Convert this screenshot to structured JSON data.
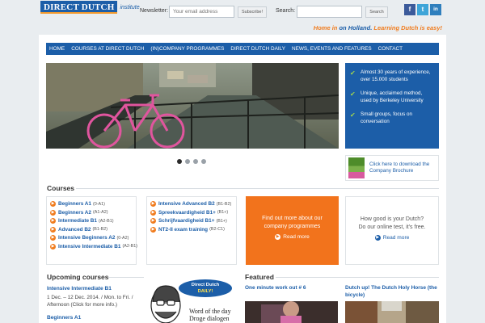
{
  "header": {
    "logo_text": "DIRECT DUTCH",
    "logo_sub": "institute",
    "newsletter_label": "Newsletter:",
    "newsletter_placeholder": "Your email address",
    "subscribe_label": "Subscribe!",
    "search_label": "Search:",
    "search_button": "Search",
    "social": [
      "f",
      "t",
      "in"
    ]
  },
  "tagline": {
    "part1": "Home in ",
    "part2": "on Holland.",
    "part3": " Learning Dutch is easy!"
  },
  "nav": [
    "HOME",
    "COURSES AT DIRECT DUTCH",
    "(IN)COMPANY PROGRAMMES",
    "DIRECT DUTCH DAILY",
    "NEWS, EVENTS AND FEATURES",
    "CONTACT"
  ],
  "usp": [
    "Almost 30 years of experience, over 15.000 students",
    "Unique, acclaimed method, used by Berkeley University",
    "Small groups, focus on conversation"
  ],
  "brochure": "Click here to download the Company Brochure",
  "courses": {
    "title": "Courses",
    "col1": [
      {
        "name": "Beginners A1",
        "level": "(0-A1)"
      },
      {
        "name": "Beginners A2",
        "level": "(A1-A2)"
      },
      {
        "name": "Intermediate B1",
        "level": "(A2-B1)"
      },
      {
        "name": "Advanced B2",
        "level": "(B1-B2)"
      },
      {
        "name": "Intensive Beginners A2",
        "level": "(0-A2)"
      },
      {
        "name": "Intensive Intermediate B1",
        "level": "(A2-B1)"
      }
    ],
    "col2": [
      {
        "name": "Intensive Advanced B2",
        "level": "(B1-B2)"
      },
      {
        "name": "Spreekvaardigheid B1+",
        "level": "(B1+)"
      },
      {
        "name": "Schrijfvaardigheid B1+",
        "level": "(B1+)"
      },
      {
        "name": "NT2-II exam training",
        "level": "(B2-C1)"
      }
    ]
  },
  "promo_orange": {
    "text": "Find out more about our company programmes",
    "more": "Read more"
  },
  "promo_grey": {
    "text": "How good is your Dutch? Do our online test, it's free.",
    "more": "Read more"
  },
  "upcoming": {
    "title": "Upcoming courses",
    "item1_title": "Intensive Intermediate B1",
    "item1_text": "1 Dec. – 12 Dec. 2014. / Mon. to Fri. / Afternoon (Click for more info.)",
    "item2_title": "Beginners A1"
  },
  "wotd": {
    "bubble1": "Direct Dutch",
    "bubble2": "DAILY!",
    "line1": "Word of the day",
    "line2": "Droge dialogen"
  },
  "featured": {
    "title": "Featured",
    "item1": "One minute work out # 6",
    "item2": "Dutch up! The Dutch Holy Horse (the bicycle)"
  },
  "colors": {
    "brand_blue": "#1c5ea8",
    "accent_orange": "#f2731c"
  }
}
